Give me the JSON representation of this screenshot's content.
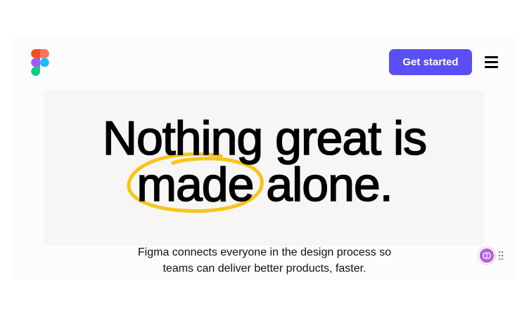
{
  "header": {
    "logo_icon": "figma-logo-icon",
    "cta_label": "Get started",
    "menu_icon": "hamburger-menu-icon"
  },
  "hero": {
    "headline_line1": "Nothing great is",
    "headline_line2_a": "made",
    "headline_line2_b": "alone.",
    "subhead_line1": "Figma connects everyone in the design process so",
    "subhead_line2": "teams can deliver better products, faster."
  },
  "colors": {
    "brand_purple": "#5a4ef5",
    "highlight_yellow": "#f5c518"
  },
  "widget": {
    "avatar_icon": "brain-avatar-icon",
    "handle_icon": "drag-handle-icon"
  }
}
